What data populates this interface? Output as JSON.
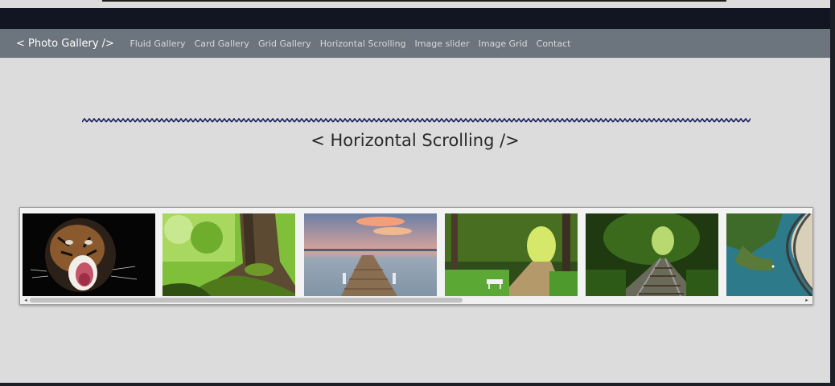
{
  "navbar": {
    "brand": "< Photo Gallery />",
    "links": [
      {
        "label": "Fluid Gallery"
      },
      {
        "label": "Card Gallery"
      },
      {
        "label": "Grid Gallery"
      },
      {
        "label": "Horizontal Scrolling"
      },
      {
        "label": "Image slider"
      },
      {
        "label": "Image Grid"
      },
      {
        "label": "Contact"
      }
    ]
  },
  "page": {
    "heading": "< Horizontal Scrolling />"
  },
  "gallery": {
    "photos": [
      {
        "subject": "roaring tiger on black background"
      },
      {
        "subject": "mossy tree roots in green forest"
      },
      {
        "subject": "wooden pier on lake at sunset"
      },
      {
        "subject": "forest path with bench"
      },
      {
        "subject": "railway track through forest"
      },
      {
        "subject": "aerial view of coastal highway"
      }
    ],
    "scrollbar": {
      "thumb_fraction": 0.56
    }
  },
  "colors": {
    "navbar": "#6c757d",
    "page_background": "#dcdcdc",
    "wave": "#1a1f5c"
  }
}
